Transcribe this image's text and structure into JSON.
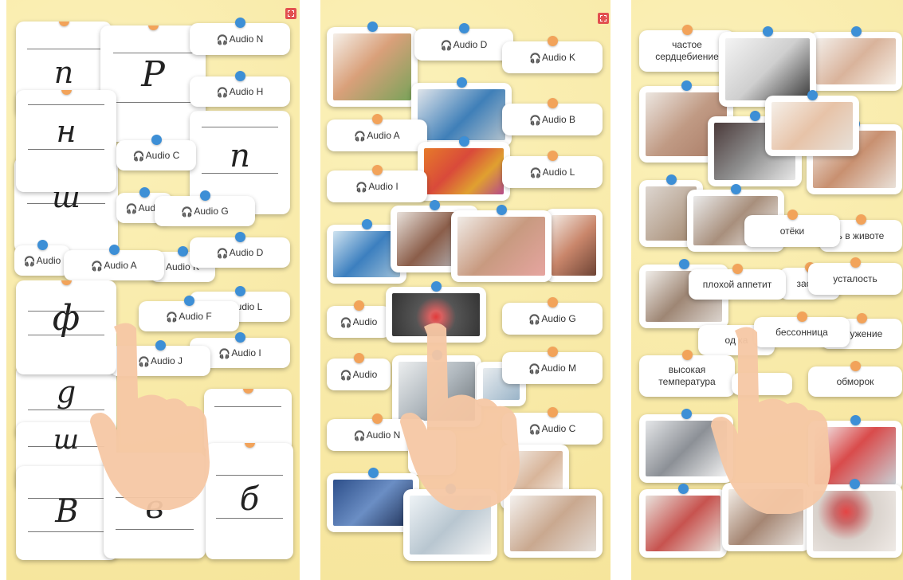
{
  "panel1": {
    "audio": [
      "Audio N",
      "Audio H",
      "Audio C",
      "Audio G",
      "Audio A",
      "Audio D",
      "Audio K",
      "Audio F",
      "Audio L",
      "Audio J",
      "Audio I",
      "Audio"
    ],
    "letters": [
      "n",
      "P",
      "н",
      "n",
      "ш",
      "ф",
      "g",
      "ш",
      "В",
      "в",
      "б"
    ]
  },
  "panel2": {
    "audio": [
      "Audio D",
      "Audio K",
      "Audio A",
      "Audio B",
      "Audio I",
      "Audio L",
      "Audio",
      "Audio G",
      "Audio",
      "Audio M",
      "Audio N",
      "Audio C"
    ]
  },
  "panel3": {
    "words": [
      "частое сердцебиение",
      "отёки",
      "ь в животе",
      "плохой аппетит",
      "засмо",
      "усталость",
      "од   ка",
      "бессонница",
      "кружение",
      "высокая температура",
      "обморок"
    ]
  },
  "icons": {
    "audio": "headphones-icon",
    "expand": "expand-icon",
    "hand": "pointing-hand-icon"
  }
}
